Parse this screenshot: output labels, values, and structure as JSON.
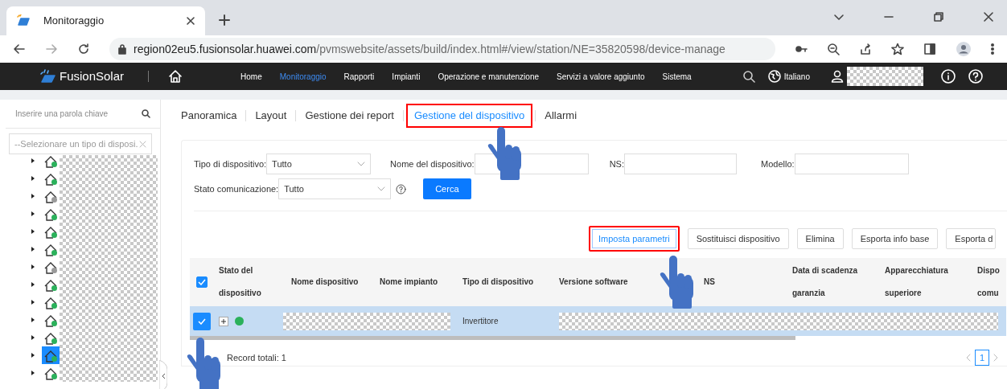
{
  "browser": {
    "tab_title": "Monitoraggio",
    "url_host": "region02eu5.fusionsolar.huawei.com",
    "url_path": "/pvmswebsite/assets/build/index.html#/view/station/NE=35820598/device-manage"
  },
  "app_nav": {
    "brand": "FusionSolar",
    "items": [
      {
        "label": "Home",
        "selected": false
      },
      {
        "label": "Monitoraggio",
        "selected": true
      },
      {
        "label": "Rapporti",
        "selected": false
      },
      {
        "label": "Impianti",
        "selected": false
      },
      {
        "label": "Operazione e manutenzione",
        "selected": false
      },
      {
        "label": "Servizi a valore aggiunto",
        "selected": false
      },
      {
        "label": "Sistema",
        "selected": false
      }
    ],
    "language": "Italiano"
  },
  "sidebar": {
    "search_placeholder": "Inserire una parola chiave",
    "type_select_placeholder": "--Selezionare un tipo di disposi.",
    "tree": [
      {
        "color": "#2bb15b",
        "selected": false
      },
      {
        "color": "#2bb15b",
        "selected": false
      },
      {
        "color": "#9a9a9a",
        "selected": false
      },
      {
        "color": "#2bb15b",
        "selected": false
      },
      {
        "color": "#2bb15b",
        "selected": false
      },
      {
        "color": "#2bb15b",
        "selected": false
      },
      {
        "color": "#9a9a9a",
        "selected": false
      },
      {
        "color": "#2bb15b",
        "selected": false
      },
      {
        "color": "#2bb15b",
        "selected": false
      },
      {
        "color": "#2bb15b",
        "selected": false
      },
      {
        "color": "#2bb15b",
        "selected": false
      },
      {
        "color": "#2bb15b",
        "selected": true
      },
      {
        "color": "#2bb15b",
        "selected": false
      }
    ]
  },
  "subtabs": [
    {
      "label": "Panoramica",
      "selected": false,
      "highlighted": false
    },
    {
      "label": "Layout",
      "selected": false,
      "highlighted": false
    },
    {
      "label": "Gestione dei report",
      "selected": false,
      "highlighted": false
    },
    {
      "label": "Gestione del dispositivo",
      "selected": true,
      "highlighted": true
    },
    {
      "label": "Allarmi",
      "selected": false,
      "highlighted": false
    }
  ],
  "filters": [
    [
      {
        "label": "Tipo di dispositivo:",
        "kind": "select",
        "value": "Tutto"
      },
      {
        "label": "Nome del dispositivo:",
        "kind": "text"
      },
      {
        "label": "NS:",
        "kind": "text"
      },
      {
        "label": "Modello:",
        "kind": "text"
      }
    ],
    [
      {
        "label": "Stato comunicazione:",
        "kind": "select",
        "value": "Tutto"
      }
    ]
  ],
  "search_button": "Cerca",
  "actions": [
    {
      "label": "Imposta parametri",
      "highlighted": true
    },
    {
      "label": "Sostituisci dispositivo",
      "highlighted": false
    },
    {
      "label": "Elimina",
      "highlighted": false
    },
    {
      "label": "Esporta info base",
      "highlighted": false
    },
    {
      "label": "Esporta d",
      "highlighted": false
    }
  ],
  "table": {
    "all_checked": true,
    "columns": [
      "Stato del dispositivo",
      "Nome dispositivo",
      "Nome impianto",
      "Tipo di dispositivo",
      "Versione software",
      "NS",
      "Data di scadenza garanzia",
      "Apparecchiatura superiore",
      "Dispo comu"
    ],
    "rows": [
      {
        "checked": true,
        "highlighted": true,
        "color": "#2bb15b",
        "device_type": "Invertitore"
      }
    ]
  },
  "footer": {
    "total": "Record totali: 1",
    "pages": [
      {
        "label": "1",
        "selected": true
      }
    ]
  }
}
